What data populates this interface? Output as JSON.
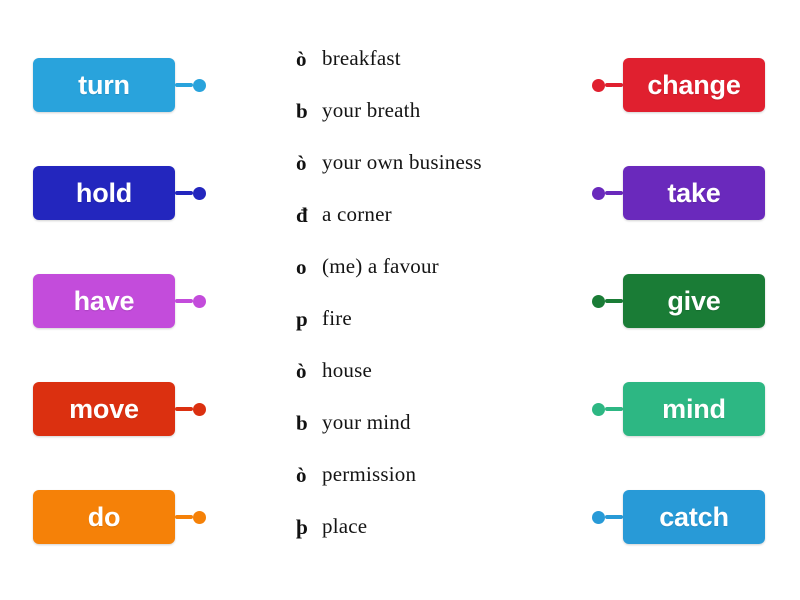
{
  "activity": {
    "type": "match-up",
    "background_color": "#ffffff"
  },
  "left_column": {
    "items": [
      {
        "label": "turn",
        "color": "#29A3DC",
        "dot_color": "#29A3DC"
      },
      {
        "label": "hold",
        "color": "#2326BE",
        "dot_color": "#2326BE"
      },
      {
        "label": "have",
        "color": "#C34CDB",
        "dot_color": "#C34CDB"
      },
      {
        "label": "move",
        "color": "#DB3010",
        "dot_color": "#DB3010"
      },
      {
        "label": "do",
        "color": "#F58108",
        "dot_color": "#F58108"
      }
    ]
  },
  "right_column": {
    "items": [
      {
        "label": "change",
        "color": "#E0202F",
        "dot_color": "#E0202F"
      },
      {
        "label": "take",
        "color": "#6A29BC",
        "dot_color": "#6A29BC"
      },
      {
        "label": "give",
        "color": "#1A7C36",
        "dot_color": "#1A7C36"
      },
      {
        "label": "mind",
        "color": "#2DB783",
        "dot_color": "#2DB783"
      },
      {
        "label": "catch",
        "color": "#289AD7",
        "dot_color": "#289AD7"
      }
    ]
  },
  "middle_column": {
    "bullet_glyph": "ö",
    "items": [
      {
        "bullet": "ò",
        "text": "breakfast"
      },
      {
        "bullet": "b",
        "text": "your breath"
      },
      {
        "bullet": "ò",
        "text": "your own business"
      },
      {
        "bullet": "đ",
        "text": "a corner"
      },
      {
        "bullet": "o",
        "text": "(me) a favour"
      },
      {
        "bullet": "p",
        "text": "fire"
      },
      {
        "bullet": "ò",
        "text": "house"
      },
      {
        "bullet": "b",
        "text": "your mind"
      },
      {
        "bullet": "ò",
        "text": "permission"
      },
      {
        "bullet": "þ",
        "text": "place"
      }
    ]
  }
}
